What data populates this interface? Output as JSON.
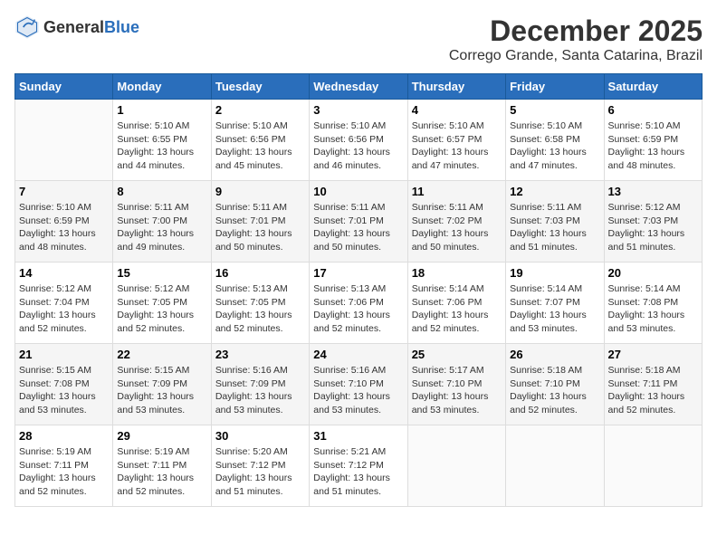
{
  "logo": {
    "text_general": "General",
    "text_blue": "Blue"
  },
  "title": {
    "month": "December 2025",
    "location": "Corrego Grande, Santa Catarina, Brazil"
  },
  "headers": [
    "Sunday",
    "Monday",
    "Tuesday",
    "Wednesday",
    "Thursday",
    "Friday",
    "Saturday"
  ],
  "weeks": [
    [
      {
        "day": "",
        "content": ""
      },
      {
        "day": "1",
        "content": "Sunrise: 5:10 AM\nSunset: 6:55 PM\nDaylight: 13 hours\nand 44 minutes."
      },
      {
        "day": "2",
        "content": "Sunrise: 5:10 AM\nSunset: 6:56 PM\nDaylight: 13 hours\nand 45 minutes."
      },
      {
        "day": "3",
        "content": "Sunrise: 5:10 AM\nSunset: 6:56 PM\nDaylight: 13 hours\nand 46 minutes."
      },
      {
        "day": "4",
        "content": "Sunrise: 5:10 AM\nSunset: 6:57 PM\nDaylight: 13 hours\nand 47 minutes."
      },
      {
        "day": "5",
        "content": "Sunrise: 5:10 AM\nSunset: 6:58 PM\nDaylight: 13 hours\nand 47 minutes."
      },
      {
        "day": "6",
        "content": "Sunrise: 5:10 AM\nSunset: 6:59 PM\nDaylight: 13 hours\nand 48 minutes."
      }
    ],
    [
      {
        "day": "7",
        "content": "Sunrise: 5:10 AM\nSunset: 6:59 PM\nDaylight: 13 hours\nand 48 minutes."
      },
      {
        "day": "8",
        "content": "Sunrise: 5:11 AM\nSunset: 7:00 PM\nDaylight: 13 hours\nand 49 minutes."
      },
      {
        "day": "9",
        "content": "Sunrise: 5:11 AM\nSunset: 7:01 PM\nDaylight: 13 hours\nand 50 minutes."
      },
      {
        "day": "10",
        "content": "Sunrise: 5:11 AM\nSunset: 7:01 PM\nDaylight: 13 hours\nand 50 minutes."
      },
      {
        "day": "11",
        "content": "Sunrise: 5:11 AM\nSunset: 7:02 PM\nDaylight: 13 hours\nand 50 minutes."
      },
      {
        "day": "12",
        "content": "Sunrise: 5:11 AM\nSunset: 7:03 PM\nDaylight: 13 hours\nand 51 minutes."
      },
      {
        "day": "13",
        "content": "Sunrise: 5:12 AM\nSunset: 7:03 PM\nDaylight: 13 hours\nand 51 minutes."
      }
    ],
    [
      {
        "day": "14",
        "content": "Sunrise: 5:12 AM\nSunset: 7:04 PM\nDaylight: 13 hours\nand 52 minutes."
      },
      {
        "day": "15",
        "content": "Sunrise: 5:12 AM\nSunset: 7:05 PM\nDaylight: 13 hours\nand 52 minutes."
      },
      {
        "day": "16",
        "content": "Sunrise: 5:13 AM\nSunset: 7:05 PM\nDaylight: 13 hours\nand 52 minutes."
      },
      {
        "day": "17",
        "content": "Sunrise: 5:13 AM\nSunset: 7:06 PM\nDaylight: 13 hours\nand 52 minutes."
      },
      {
        "day": "18",
        "content": "Sunrise: 5:14 AM\nSunset: 7:06 PM\nDaylight: 13 hours\nand 52 minutes."
      },
      {
        "day": "19",
        "content": "Sunrise: 5:14 AM\nSunset: 7:07 PM\nDaylight: 13 hours\nand 53 minutes."
      },
      {
        "day": "20",
        "content": "Sunrise: 5:14 AM\nSunset: 7:08 PM\nDaylight: 13 hours\nand 53 minutes."
      }
    ],
    [
      {
        "day": "21",
        "content": "Sunrise: 5:15 AM\nSunset: 7:08 PM\nDaylight: 13 hours\nand 53 minutes."
      },
      {
        "day": "22",
        "content": "Sunrise: 5:15 AM\nSunset: 7:09 PM\nDaylight: 13 hours\nand 53 minutes."
      },
      {
        "day": "23",
        "content": "Sunrise: 5:16 AM\nSunset: 7:09 PM\nDaylight: 13 hours\nand 53 minutes."
      },
      {
        "day": "24",
        "content": "Sunrise: 5:16 AM\nSunset: 7:10 PM\nDaylight: 13 hours\nand 53 minutes."
      },
      {
        "day": "25",
        "content": "Sunrise: 5:17 AM\nSunset: 7:10 PM\nDaylight: 13 hours\nand 53 minutes."
      },
      {
        "day": "26",
        "content": "Sunrise: 5:18 AM\nSunset: 7:10 PM\nDaylight: 13 hours\nand 52 minutes."
      },
      {
        "day": "27",
        "content": "Sunrise: 5:18 AM\nSunset: 7:11 PM\nDaylight: 13 hours\nand 52 minutes."
      }
    ],
    [
      {
        "day": "28",
        "content": "Sunrise: 5:19 AM\nSunset: 7:11 PM\nDaylight: 13 hours\nand 52 minutes."
      },
      {
        "day": "29",
        "content": "Sunrise: 5:19 AM\nSunset: 7:11 PM\nDaylight: 13 hours\nand 52 minutes."
      },
      {
        "day": "30",
        "content": "Sunrise: 5:20 AM\nSunset: 7:12 PM\nDaylight: 13 hours\nand 51 minutes."
      },
      {
        "day": "31",
        "content": "Sunrise: 5:21 AM\nSunset: 7:12 PM\nDaylight: 13 hours\nand 51 minutes."
      },
      {
        "day": "",
        "content": ""
      },
      {
        "day": "",
        "content": ""
      },
      {
        "day": "",
        "content": ""
      }
    ]
  ]
}
